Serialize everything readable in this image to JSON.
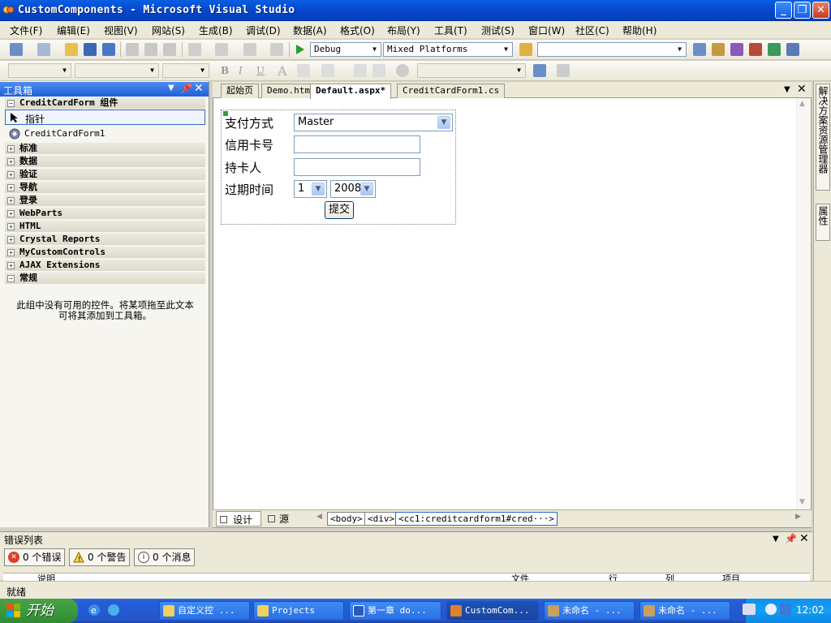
{
  "window": {
    "title": "CustomComponents - Microsoft Visual Studio"
  },
  "menu": [
    "文件(F)",
    "编辑(E)",
    "视图(V)",
    "网站(S)",
    "生成(B)",
    "调试(D)",
    "数据(A)",
    "格式(O)",
    "布局(Y)",
    "工具(T)",
    "测试(S)",
    "窗口(W)",
    "社区(C)",
    "帮助(H)"
  ],
  "toolbar": {
    "config": "Debug",
    "platform": "Mixed Platforms"
  },
  "toolbox": {
    "title": "工具箱",
    "header_group": "CreditCardForm 组件",
    "pointer": "指针",
    "component": "CreditCardForm1",
    "groups": [
      "标准",
      "数据",
      "验证",
      "导航",
      "登录",
      "WebParts",
      "HTML",
      "Crystal Reports",
      "MyCustomControls",
      "AJAX Extensions",
      "常规"
    ],
    "empty_msg_1": "此组中没有可用的控件。将某项拖至此文本",
    "empty_msg_2": "可将其添加到工具箱。"
  },
  "tabs": [
    "起始页",
    "Demo.htm",
    "Default.aspx*",
    "CreditCardForm1.cs"
  ],
  "form": {
    "pay_label": "支付方式",
    "pay_value": "Master",
    "card_label": "信用卡号",
    "holder_label": "持卡人",
    "expiry_label": "过期时间",
    "month_value": "1",
    "year_value": "2008",
    "submit": "提交"
  },
  "design": {
    "design_tab": "设计",
    "source_tab": "源",
    "crumbs": [
      "<body>",
      "<div>",
      "<cc1:creditcardform1#cred···>"
    ]
  },
  "errors": {
    "title": "错误列表",
    "errors_btn": "0 个错误",
    "warnings_btn": "0 个警告",
    "messages_btn": "0 个消息",
    "columns": [
      "说明",
      "文件",
      "行",
      "列",
      "项目"
    ]
  },
  "status": "就绪",
  "side_tabs": [
    "解决方案资源管理器",
    "属性"
  ],
  "taskbar": {
    "start": "开始",
    "tasks": [
      "自定义控 ...",
      "Projects",
      "第一章 do...",
      "CustomCom...",
      "未命名 - ...",
      "未命名 - ..."
    ],
    "clock": "12:02"
  },
  "colors": {
    "titlebar": "#0547cc",
    "taskbar": "#245edb",
    "start": "#3c9a3c"
  }
}
